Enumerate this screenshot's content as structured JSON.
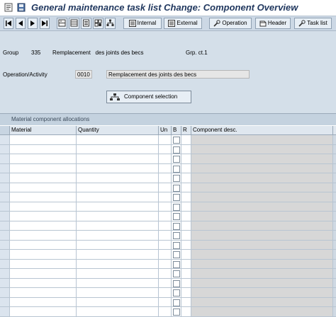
{
  "window": {
    "title": "General maintenance task list Change: Component Overview"
  },
  "toolbar": {
    "internal_label": "Internal",
    "external_label": "External",
    "operation_label": "Operation",
    "header_label": "Header",
    "tasklist_label": "Task list"
  },
  "header": {
    "group_label": "Group",
    "group_value": "335",
    "group_desc": "Remplacement   des joints des becs",
    "grpct_label": "Grp. ct.1",
    "operation_label": "Operation/Activity",
    "operation_value": "0010",
    "operation_desc": "Remplacement des joints des becs",
    "component_selection_label": "Component selection"
  },
  "table": {
    "title": "Material component allocations",
    "columns": [
      "Material",
      "Quantity",
      "Un",
      "B",
      "R",
      "Component desc."
    ],
    "row_count": 19
  }
}
